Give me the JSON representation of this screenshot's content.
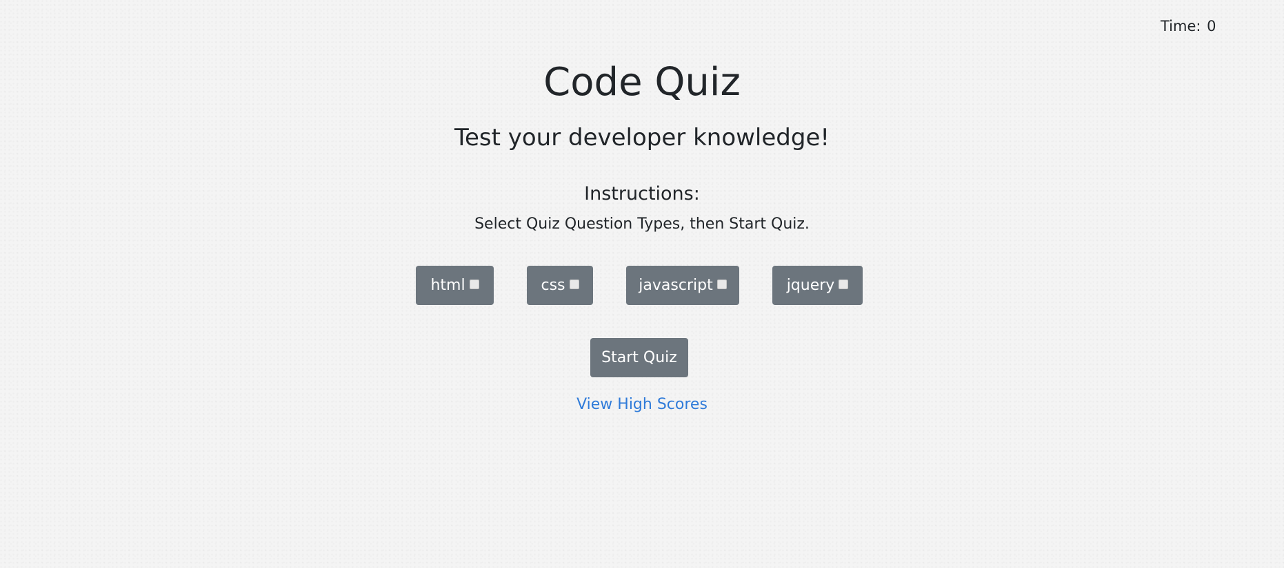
{
  "timer": {
    "label": "Time:",
    "value": "0"
  },
  "header": {
    "title": "Code Quiz",
    "subtitle": "Test your developer knowledge!"
  },
  "instructions": {
    "heading": "Instructions:",
    "text": "Select Quiz Question Types, then Start Quiz."
  },
  "topics": [
    {
      "label": "html",
      "checked": false
    },
    {
      "label": "css",
      "checked": false
    },
    {
      "label": "javascript",
      "checked": false
    },
    {
      "label": "jquery",
      "checked": false
    }
  ],
  "actions": {
    "start_label": "Start Quiz",
    "high_scores_label": "View High Scores"
  },
  "colors": {
    "button_bg": "#6c757d",
    "link": "#2f7bd9",
    "text": "#212529",
    "background": "#f4f4f4"
  }
}
